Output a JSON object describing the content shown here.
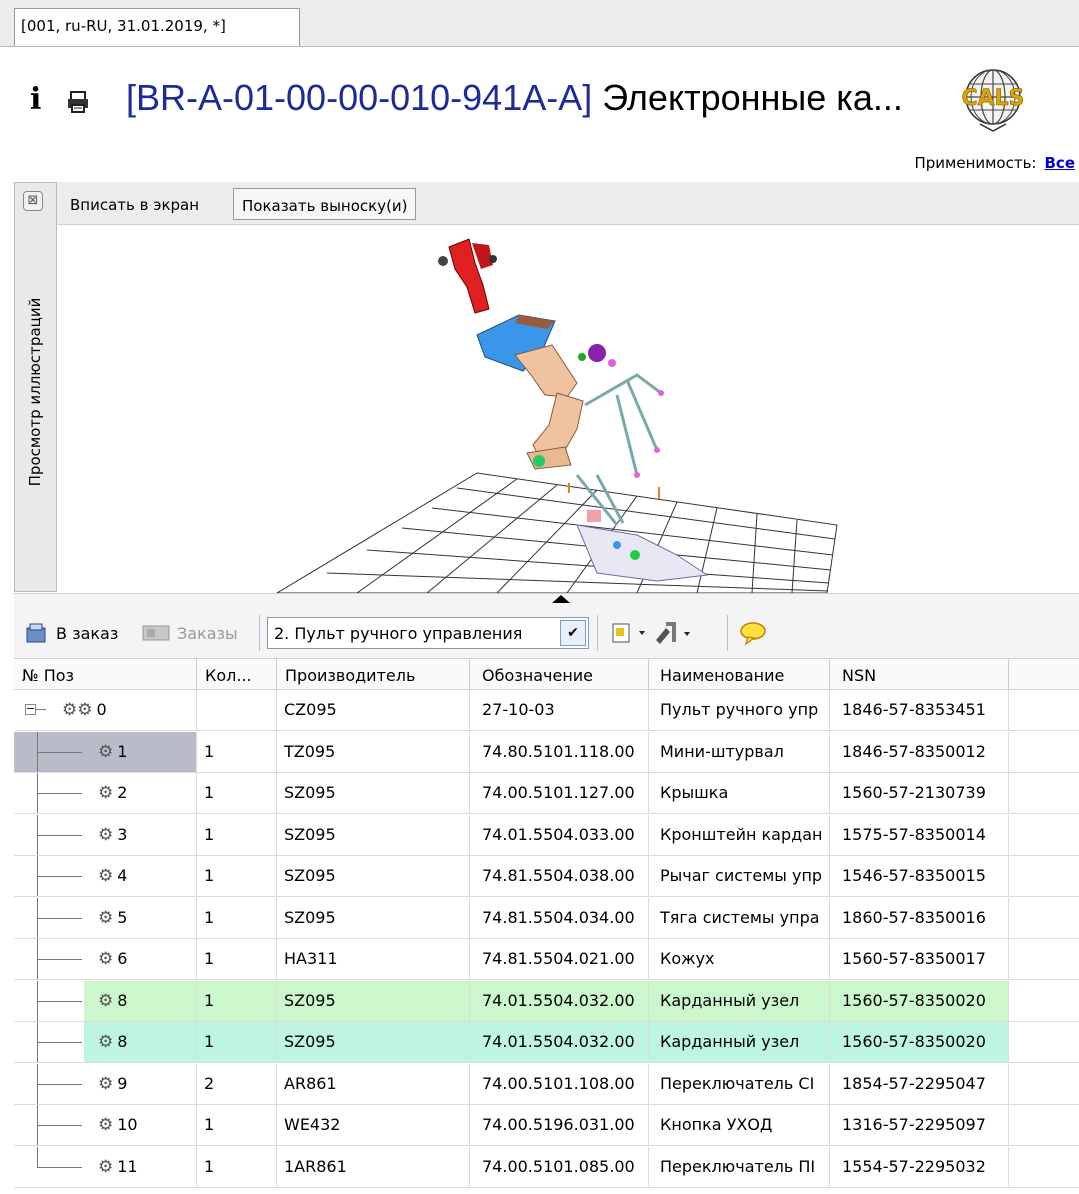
{
  "tab": {
    "label": "[001, ru-RU, 31.01.2019, *]"
  },
  "header": {
    "title_code": "[BR-A-01-00-00-010-941A-A]",
    "title_text": " Электронные ка...",
    "applicability_label": "Применимость:",
    "applicability_value": "Все",
    "logo_text": "CALS"
  },
  "sidebar": {
    "label": "Просмотр иллюстраций"
  },
  "viewer_toolbar": {
    "fit_label": "Вписать в экран",
    "callouts_label": "Показать выноску(и)"
  },
  "toolbar": {
    "add_order_label": "В заказ",
    "orders_label": "Заказы",
    "combo_value": "2. Пульт ручного управления"
  },
  "grid": {
    "columns": [
      "№ Поз",
      "Кол...",
      "Производитель",
      "Обозначение",
      "Наименование",
      "NSN"
    ],
    "rows": [
      {
        "pos": "0",
        "qty": "",
        "maker": "CZ095",
        "code": "27-10-03",
        "name": "Пульт ручного упр",
        "nsn": "1846-57-8353451"
      },
      {
        "pos": "1",
        "qty": "1",
        "maker": "TZ095",
        "code": "74.80.5101.118.00",
        "name": "Мини-штурвал",
        "nsn": "1846-57-8350012"
      },
      {
        "pos": "2",
        "qty": "1",
        "maker": "SZ095",
        "code": "74.00.5101.127.00",
        "name": "Крышка",
        "nsn": "1560-57-2130739"
      },
      {
        "pos": "3",
        "qty": "1",
        "maker": "SZ095",
        "code": "74.01.5504.033.00",
        "name": "Кронштейн кардан",
        "nsn": "1575-57-8350014"
      },
      {
        "pos": "4",
        "qty": "1",
        "maker": "SZ095",
        "code": "74.81.5504.038.00",
        "name": "Рычаг системы упр",
        "nsn": "1546-57-8350015"
      },
      {
        "pos": "5",
        "qty": "1",
        "maker": "SZ095",
        "code": "74.81.5504.034.00",
        "name": "Тяга системы упра",
        "nsn": "1860-57-8350016"
      },
      {
        "pos": "6",
        "qty": "1",
        "maker": "HA311",
        "code": "74.81.5504.021.00",
        "name": "Кожух",
        "nsn": "1560-57-8350017"
      },
      {
        "pos": "8",
        "qty": "1",
        "maker": "SZ095",
        "code": "74.01.5504.032.00",
        "name": "Карданный узел",
        "nsn": "1560-57-8350020"
      },
      {
        "pos": "8",
        "qty": "1",
        "maker": "SZ095",
        "code": "74.01.5504.032.00",
        "name": "Карданный узел",
        "nsn": "1560-57-8350020"
      },
      {
        "pos": "9",
        "qty": "2",
        "maker": "AR861",
        "code": "74.00.5101.108.00",
        "name": "Переключатель СІ",
        "nsn": "1854-57-2295047"
      },
      {
        "pos": "10",
        "qty": "1",
        "maker": "WE432",
        "code": "74.00.5196.031.00",
        "name": "Кнопка УХОД",
        "nsn": "1316-57-2295097"
      },
      {
        "pos": "11",
        "qty": "1",
        "maker": "1AR861",
        "code": "74.00.5101.085.00",
        "name": "Переключатель ПІ",
        "nsn": "1554-57-2295032"
      }
    ]
  },
  "colors": {
    "title_code": "#1c2a9a",
    "highlight_green": "#ccf7cc",
    "highlight_teal": "#bdf5e2",
    "selection": "#b7bcc8"
  }
}
